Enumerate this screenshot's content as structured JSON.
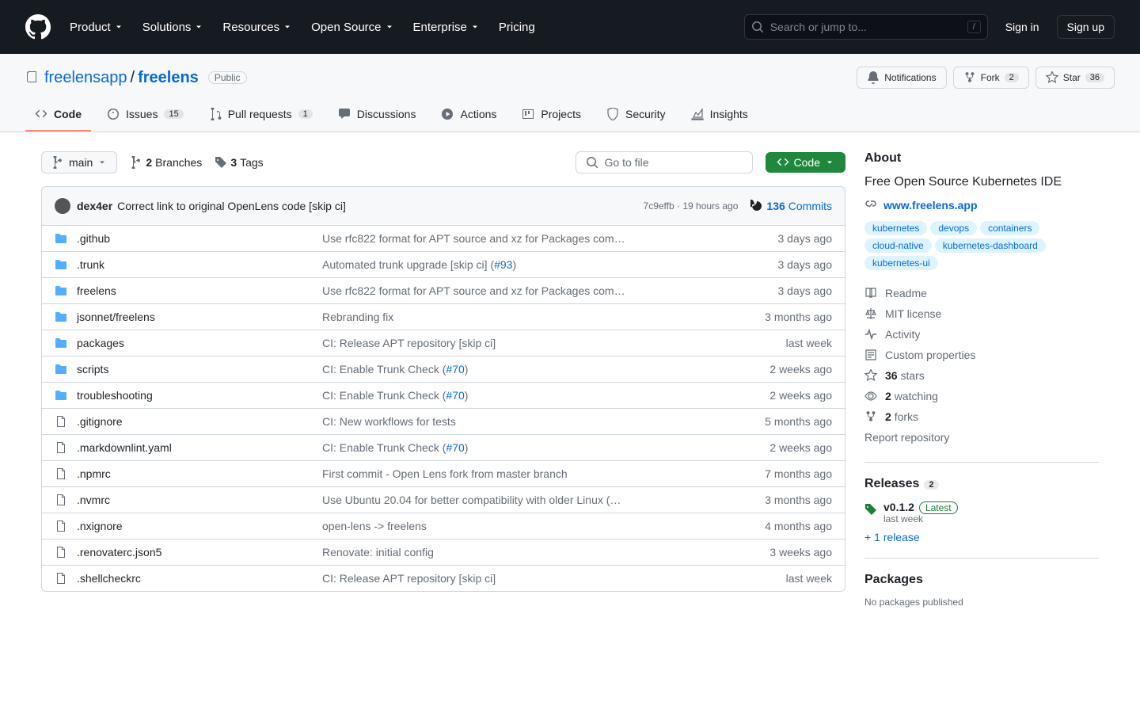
{
  "header": {
    "nav": [
      "Product",
      "Solutions",
      "Resources",
      "Open Source",
      "Enterprise",
      "Pricing"
    ],
    "search_placeholder": "Search or jump to...",
    "search_kbd": "/",
    "sign_in": "Sign in",
    "sign_up": "Sign up"
  },
  "repo": {
    "owner": "freelensapp",
    "name": "freelens",
    "visibility": "Public",
    "notifications": "Notifications",
    "fork": "Fork",
    "fork_count": "2",
    "star": "Star",
    "star_count": "36"
  },
  "tabs": [
    {
      "label": "Code",
      "count": null,
      "active": true
    },
    {
      "label": "Issues",
      "count": "15"
    },
    {
      "label": "Pull requests",
      "count": "1"
    },
    {
      "label": "Discussions",
      "count": null
    },
    {
      "label": "Actions",
      "count": null
    },
    {
      "label": "Projects",
      "count": null
    },
    {
      "label": "Security",
      "count": null
    },
    {
      "label": "Insights",
      "count": null
    }
  ],
  "toolbar": {
    "branch": "main",
    "branches_count": "2",
    "branches_label": "Branches",
    "tags_count": "3",
    "tags_label": "Tags",
    "go_to_file": "Go to file",
    "code_btn": "Code"
  },
  "latest_commit": {
    "author": "dex4er",
    "message": "Correct link to original OpenLens code [skip ci]",
    "sha": "7c9effb",
    "time": "19 hours ago",
    "commits_count": "136",
    "commits_label": "Commits"
  },
  "files": [
    {
      "type": "dir",
      "name": ".github",
      "msg": "Use rfc822 format for APT source and xz for Packages com…",
      "time": "3 days ago"
    },
    {
      "type": "dir",
      "name": ".trunk",
      "msg": "Automated trunk upgrade [skip ci] (",
      "link": "#93",
      "msg2": ")",
      "time": "3 days ago"
    },
    {
      "type": "dir",
      "name": "freelens",
      "msg": "Use rfc822 format for APT source and xz for Packages com…",
      "time": "3 days ago"
    },
    {
      "type": "dir",
      "name": "jsonnet/freelens",
      "msg": "Rebranding fix",
      "time": "3 months ago"
    },
    {
      "type": "dir",
      "name": "packages",
      "msg": "CI: Release APT repository [skip ci]",
      "time": "last week"
    },
    {
      "type": "dir",
      "name": "scripts",
      "msg": "CI: Enable Trunk Check (",
      "link": "#70",
      "msg2": ")",
      "time": "2 weeks ago"
    },
    {
      "type": "dir",
      "name": "troubleshooting",
      "msg": "CI: Enable Trunk Check (",
      "link": "#70",
      "msg2": ")",
      "time": "2 weeks ago"
    },
    {
      "type": "file",
      "name": ".gitignore",
      "msg": "CI: New workflows for tests",
      "time": "5 months ago"
    },
    {
      "type": "file",
      "name": ".markdownlint.yaml",
      "msg": "CI: Enable Trunk Check (",
      "link": "#70",
      "msg2": ")",
      "time": "2 weeks ago"
    },
    {
      "type": "file",
      "name": ".npmrc",
      "msg": "First commit - Open Lens fork from master branch",
      "time": "7 months ago"
    },
    {
      "type": "file",
      "name": ".nvmrc",
      "msg": "Use Ubuntu 20.04 for better compatibility with older Linux (…",
      "time": "3 months ago"
    },
    {
      "type": "file",
      "name": ".nxignore",
      "msg": "open-lens -> freelens",
      "time": "4 months ago"
    },
    {
      "type": "file",
      "name": ".renovaterc.json5",
      "msg": "Renovate: initial config",
      "time": "3 weeks ago"
    },
    {
      "type": "file",
      "name": ".shellcheckrc",
      "msg": "CI: Release APT repository [skip ci]",
      "time": "last week"
    }
  ],
  "about": {
    "title": "About",
    "desc": "Free Open Source Kubernetes IDE",
    "link": "www.freelens.app",
    "topics": [
      "kubernetes",
      "devops",
      "containers",
      "cloud-native",
      "kubernetes-dashboard",
      "kubernetes-ui"
    ],
    "items": {
      "readme": "Readme",
      "license": "MIT license",
      "activity": "Activity",
      "custom": "Custom properties",
      "stars_n": "36",
      "stars_l": "stars",
      "watch_n": "2",
      "watch_l": "watching",
      "forks_n": "2",
      "forks_l": "forks",
      "report": "Report repository"
    }
  },
  "releases": {
    "title": "Releases",
    "count": "2",
    "version": "v0.1.2",
    "latest": "Latest",
    "time": "last week",
    "more": "+ 1 release"
  },
  "packages": {
    "title": "Packages",
    "msg": "No packages published"
  }
}
